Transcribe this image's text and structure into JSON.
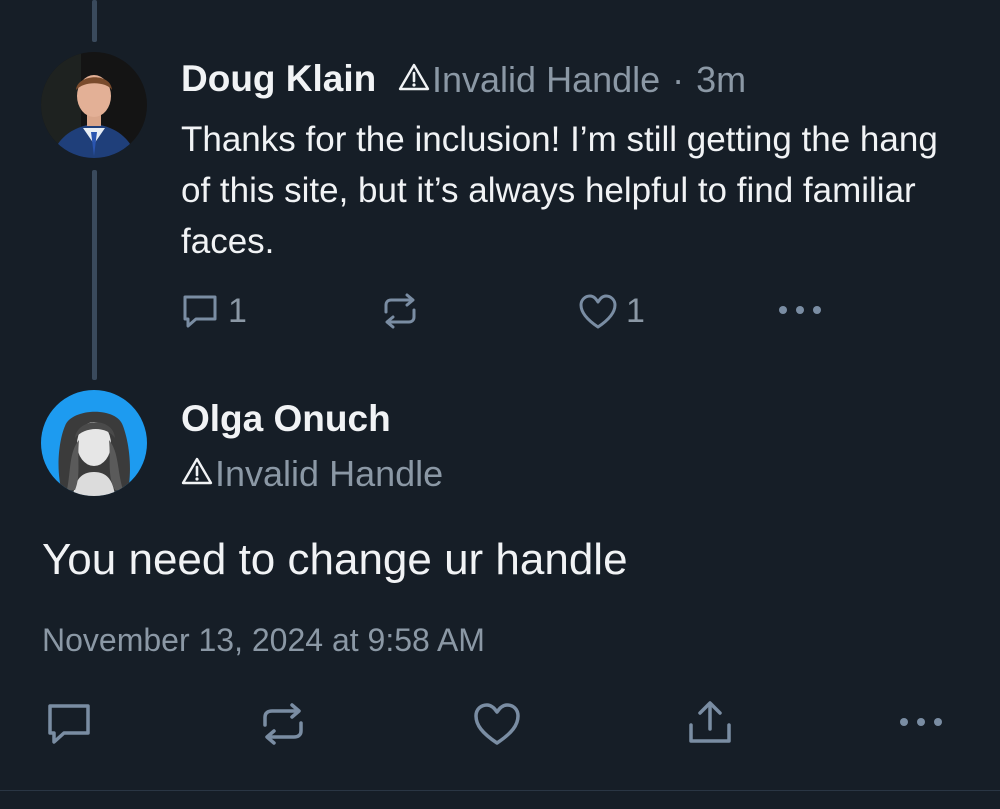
{
  "reply": {
    "author_name": "Doug Klain",
    "handle": "Invalid Handle",
    "separator": "·",
    "time_ago": "3m",
    "text": "Thanks for the inclusion! I’m still getting the hang of this site, but it’s always helpful to find familiar faces.",
    "reply_count": "1",
    "like_count": "1",
    "icons": [
      "reply-icon",
      "repost-icon",
      "like-icon",
      "more-icon",
      "warning-icon"
    ]
  },
  "main_post": {
    "author_name": "Olga Onuch",
    "handle": "Invalid Handle",
    "text": "You need to change ur handle",
    "timestamp": "November 13, 2024 at 9:58 AM",
    "icons": [
      "reply-icon",
      "repost-icon",
      "like-icon",
      "share-icon",
      "more-icon",
      "warning-icon"
    ]
  },
  "colors": {
    "background": "#161e27",
    "primary_text": "#f1f3f5",
    "secondary_text": "#8b98a5",
    "action_icon": "#7a8da3",
    "avatar_bg_olga": "#1d9bf0"
  }
}
